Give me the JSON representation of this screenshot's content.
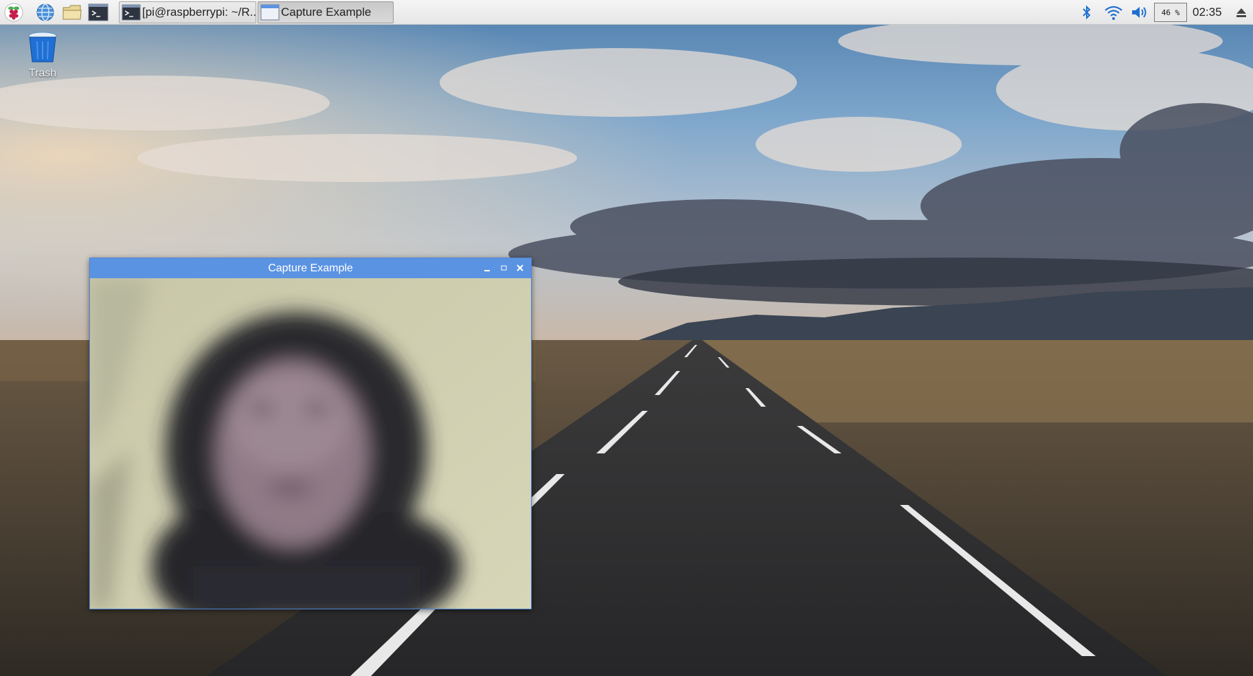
{
  "taskbar": {
    "launchers": [
      {
        "name": "raspberry-menu-icon"
      },
      {
        "name": "web-browser-icon"
      },
      {
        "name": "file-manager-icon"
      },
      {
        "name": "terminal-icon"
      }
    ],
    "tasks": [
      {
        "label": "[pi@raspberrypi: ~/R...",
        "icon": "terminal-icon",
        "active": false
      },
      {
        "label": "Capture Example",
        "icon": "window-icon",
        "active": true
      }
    ],
    "tray": {
      "bluetooth_icon": "bluetooth-icon",
      "wifi_icon": "wifi-icon",
      "volume_icon": "volume-icon",
      "cpu_percent": "46 %",
      "clock": "02:35",
      "eject_icon": "eject-icon"
    }
  },
  "desktop": {
    "trash_label": "Trash"
  },
  "window": {
    "title": "Capture Example",
    "minimize_label": "‗",
    "maximize_label": "▫",
    "close_label": "✕"
  },
  "colors": {
    "titlebar": "#5b93e3",
    "taskbar": "#ececec",
    "window_border": "#4f86d8"
  }
}
